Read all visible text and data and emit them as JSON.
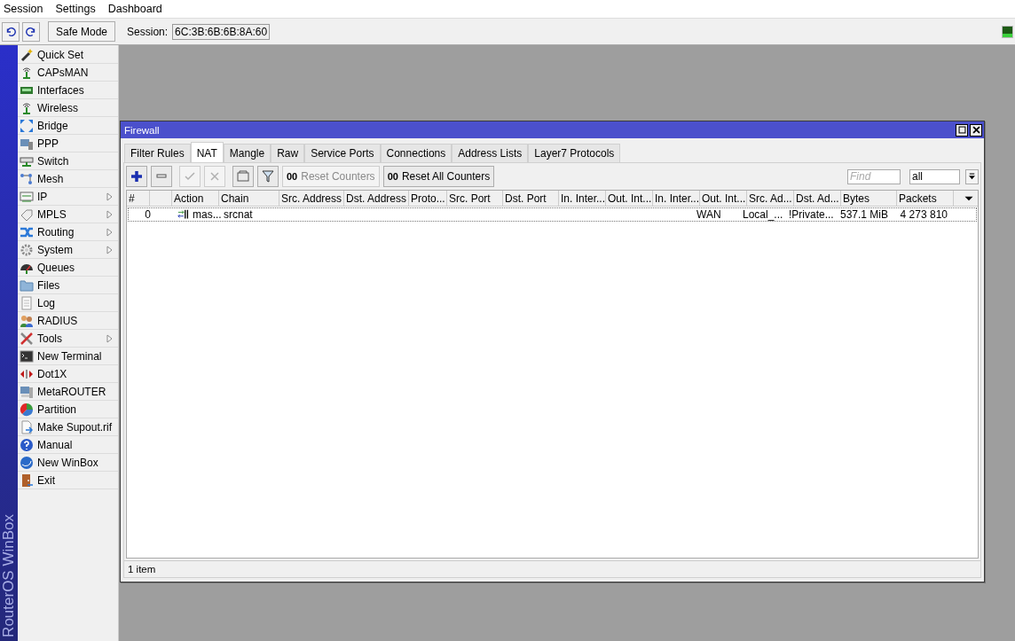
{
  "menubar": [
    "Session",
    "Settings",
    "Dashboard"
  ],
  "toolbar": {
    "safe_mode": {
      "label": "Safe Mode",
      "on": false
    },
    "session_label": "Session:",
    "session_value": "6C:3B:6B:6B:8A:60"
  },
  "sidebar": {
    "brand": "RouterOS WinBox",
    "items": [
      {
        "label": "Quick Set",
        "submenu": false
      },
      {
        "label": "CAPsMAN",
        "submenu": false
      },
      {
        "label": "Interfaces",
        "submenu": false
      },
      {
        "label": "Wireless",
        "submenu": false
      },
      {
        "label": "Bridge",
        "submenu": false
      },
      {
        "label": "PPP",
        "submenu": false
      },
      {
        "label": "Switch",
        "submenu": false
      },
      {
        "label": "Mesh",
        "submenu": false
      },
      {
        "label": "IP",
        "submenu": true
      },
      {
        "label": "MPLS",
        "submenu": true
      },
      {
        "label": "Routing",
        "submenu": true
      },
      {
        "label": "System",
        "submenu": true
      },
      {
        "label": "Queues",
        "submenu": false
      },
      {
        "label": "Files",
        "submenu": false
      },
      {
        "label": "Log",
        "submenu": false
      },
      {
        "label": "RADIUS",
        "submenu": false
      },
      {
        "label": "Tools",
        "submenu": true
      },
      {
        "label": "New Terminal",
        "submenu": false
      },
      {
        "label": "Dot1X",
        "submenu": false
      },
      {
        "label": "MetaROUTER",
        "submenu": false
      },
      {
        "label": "Partition",
        "submenu": false
      },
      {
        "label": "Make Supout.rif",
        "submenu": false
      },
      {
        "label": "Manual",
        "submenu": false
      },
      {
        "label": "New WinBox",
        "submenu": false
      },
      {
        "label": "Exit",
        "submenu": false
      }
    ]
  },
  "window": {
    "title": "Firewall",
    "tabs": [
      {
        "label": "Filter Rules",
        "selected": false
      },
      {
        "label": "NAT",
        "selected": true
      },
      {
        "label": "Mangle",
        "selected": false
      },
      {
        "label": "Raw",
        "selected": false
      },
      {
        "label": "Service Ports",
        "selected": false
      },
      {
        "label": "Connections",
        "selected": false
      },
      {
        "label": "Address Lists",
        "selected": false
      },
      {
        "label": "Layer7 Protocols",
        "selected": false
      }
    ],
    "tools": [
      {
        "kind": "add",
        "disabled": false
      },
      {
        "kind": "remove",
        "disabled": false
      },
      {
        "kind": "enable",
        "disabled": true
      },
      {
        "kind": "disable",
        "disabled": true
      },
      {
        "kind": "comment",
        "disabled": false
      },
      {
        "kind": "filter",
        "disabled": false
      },
      {
        "kind": "text",
        "glyph": "00",
        "label": "Reset Counters",
        "disabled": true
      },
      {
        "kind": "text",
        "glyph": "00",
        "label": "Reset All Counters",
        "disabled": false
      }
    ],
    "find": {
      "placeholder": "Find"
    },
    "select": {
      "value": "all"
    },
    "columns": [
      "#",
      "",
      "Action",
      "Chain",
      "Src. Address",
      "Dst. Address",
      "Proto...",
      "Src. Port",
      "Dst. Port",
      "In. Inter...",
      "Out. Int...",
      "In. Inter...",
      "Out. Int...",
      "Src. Ad...",
      "Dst. Ad...",
      "Bytes",
      "Packets"
    ],
    "rows": [
      {
        "number": "0",
        "action": "mas...",
        "chain": "srcnat",
        "out_interface_list": "WAN",
        "src_address_list": "Local_...",
        "dst_address_list": "!Private...",
        "bytes": "537.1 MiB",
        "packets": "4 273 810"
      }
    ],
    "status": "1 item"
  }
}
